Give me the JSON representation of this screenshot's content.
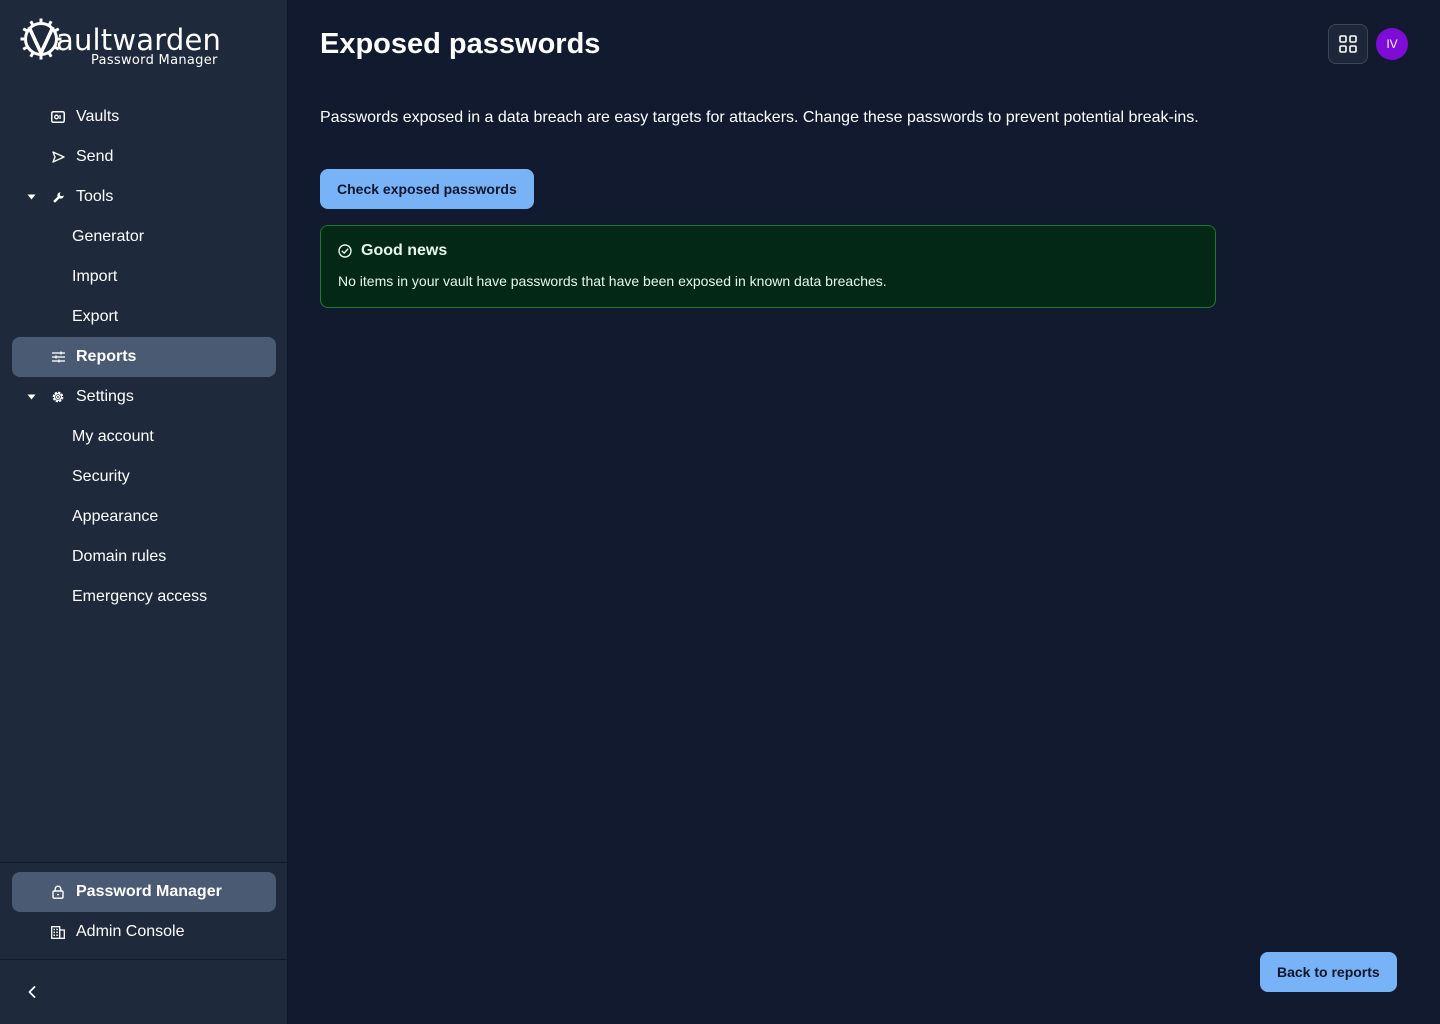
{
  "brand": {
    "wordmark": "aultwarden",
    "subtitle": "Password Manager"
  },
  "sidebar": {
    "items": [
      {
        "label": "Vaults",
        "icon": "vault-icon"
      },
      {
        "label": "Send",
        "icon": "send-icon"
      },
      {
        "label": "Tools",
        "icon": "wrench-icon",
        "expanded": true
      },
      {
        "label": "Generator"
      },
      {
        "label": "Import"
      },
      {
        "label": "Export"
      },
      {
        "label": "Reports",
        "icon": "sliders-icon",
        "active": true
      },
      {
        "label": "Settings",
        "icon": "gear-icon",
        "expanded": true
      },
      {
        "label": "My account"
      },
      {
        "label": "Security"
      },
      {
        "label": "Appearance"
      },
      {
        "label": "Domain rules"
      },
      {
        "label": "Emergency access"
      }
    ],
    "products": [
      {
        "label": "Password Manager",
        "icon": "lock-icon",
        "active": true
      },
      {
        "label": "Admin Console",
        "icon": "building-icon"
      }
    ],
    "collapse_icon": "chevron-left-icon"
  },
  "header": {
    "title": "Exposed passwords",
    "apps_icon": "grid-icon",
    "avatar_initials": "IV"
  },
  "main": {
    "description": "Passwords exposed in a data breach are easy targets for attackers. Change these passwords to prevent potential break-ins.",
    "check_button": "Check exposed passwords",
    "callout": {
      "title": "Good news",
      "body": "No items in your vault have passwords that have been exposed in known data breaches.",
      "icon": "check-circle-icon"
    },
    "back_button": "Back to reports"
  },
  "colors": {
    "background": "#111a2e",
    "sidebar": "#1e293b",
    "active_item": "#4a5a72",
    "primary_button": "#79b3f7",
    "success_bg": "#032916",
    "success_border": "#1b7a32",
    "avatar": "#7e0bd6"
  }
}
